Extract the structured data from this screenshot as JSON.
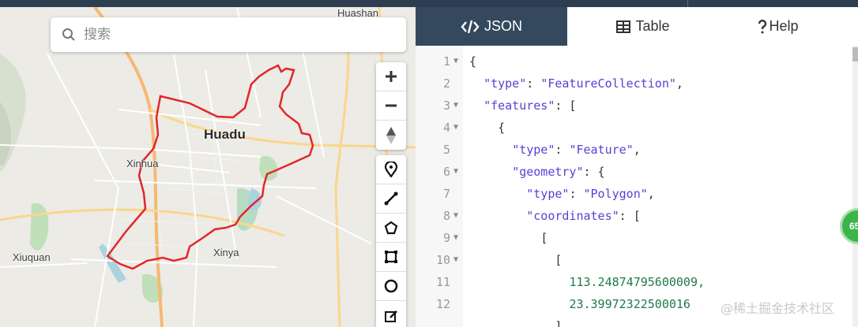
{
  "map": {
    "search_placeholder": "搜索",
    "places": {
      "huadu": "Huadu",
      "xinhua": "Xinhua",
      "xinya": "Xinya",
      "xiuquan": "Xiuquan",
      "huashan": "Huashan"
    },
    "polygon_color": "#e3262b",
    "controls": {
      "zoom": [
        "zoom-in-icon",
        "zoom-out-icon",
        "compass-icon"
      ],
      "draw": [
        "marker-icon",
        "line-icon",
        "polygon-icon",
        "rectangle-icon",
        "circle-icon",
        "edit-icon"
      ]
    }
  },
  "panel": {
    "tabs": [
      {
        "label": "JSON",
        "icon": "code-icon",
        "active": true
      },
      {
        "label": "Table",
        "icon": "table-icon",
        "active": false
      },
      {
        "label": "Help",
        "icon": "question-icon",
        "active": false
      }
    ],
    "accent": "#34495e",
    "lines": [
      {
        "n": "1",
        "fold": true
      },
      {
        "n": "2",
        "fold": false
      },
      {
        "n": "3",
        "fold": true
      },
      {
        "n": "4",
        "fold": true
      },
      {
        "n": "5",
        "fold": false
      },
      {
        "n": "6",
        "fold": true
      },
      {
        "n": "7",
        "fold": false
      },
      {
        "n": "8",
        "fold": true
      },
      {
        "n": "9",
        "fold": true
      },
      {
        "n": "10",
        "fold": true
      },
      {
        "n": "11",
        "fold": false
      },
      {
        "n": "12",
        "fold": false
      }
    ],
    "code": {
      "l1": "{",
      "l2_key": "\"type\"",
      "l2_val": "\"FeatureCollection\"",
      "l3_key": "\"features\"",
      "l3_rest": ": [",
      "l4": "{",
      "l5_key": "\"type\"",
      "l5_val": "\"Feature\"",
      "l6_key": "\"geometry\"",
      "l6_rest": ": {",
      "l7_key": "\"type\"",
      "l7_val": "\"Polygon\"",
      "l8_key": "\"coordinates\"",
      "l8_rest": ": [",
      "l9": "[",
      "l10": "[",
      "l11": "113.24874795600009,",
      "l12": "23.39972322500016",
      "l13": "],"
    }
  },
  "badge": "65",
  "watermark": "@稀土掘金技术社区"
}
